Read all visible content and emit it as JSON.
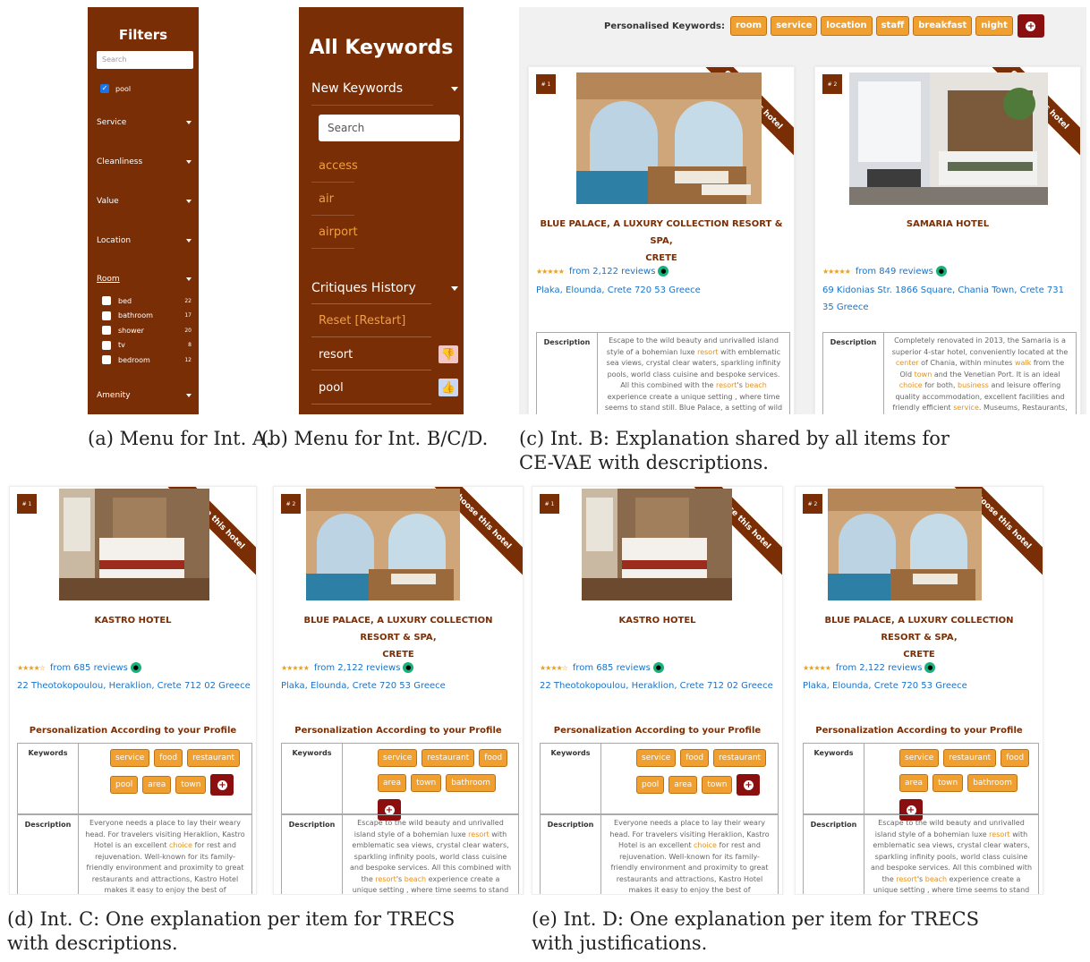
{
  "captions": {
    "a": "(a) Menu for Int. A.",
    "b": "(b) Menu for Int. B/C/D.",
    "c1": "(c) Int. B: Explanation shared by all items for",
    "c2": "CE-VAE with descriptions.",
    "d1": "(d) Int.  C: One explanation per item for TRECS",
    "d2": "with descriptions.",
    "e1": "(e) Int. D: One explanation per item for TRECS",
    "e2": "with justifications."
  },
  "menu_a": {
    "title": "Filters",
    "search_placeholder": "Search",
    "checked_item": "pool",
    "sections": [
      "Service",
      "Cleanliness",
      "Value",
      "Location",
      "Room",
      "Amenity"
    ],
    "room_items": [
      {
        "label": "bed",
        "count": "22"
      },
      {
        "label": "bathroom",
        "count": "17"
      },
      {
        "label": "shower",
        "count": "20"
      },
      {
        "label": "tv",
        "count": "8"
      },
      {
        "label": "bedroom",
        "count": "12"
      }
    ]
  },
  "menu_b": {
    "title": "All Keywords",
    "new_keywords": "New Keywords",
    "search_placeholder": "Search",
    "keywords": [
      "access",
      "air",
      "airport"
    ],
    "critiques_history": "Critiques History",
    "reset": "Reset [Restart]",
    "history": [
      {
        "label": "resort",
        "vote": "down"
      },
      {
        "label": "pool",
        "vote": "up"
      }
    ]
  },
  "common": {
    "ribbon": "Choose this hotel",
    "description_label": "Description",
    "keywords_label": "Keywords",
    "personalization_title": "Personalization According to your Profile",
    "plus": "+"
  },
  "panel_c": {
    "personalised_label": "Personalised Keywords:",
    "keywords": [
      "room",
      "service",
      "location",
      "staff",
      "breakfast",
      "night"
    ],
    "hotels": [
      {
        "rank": "# 1",
        "name_line1": "BLUE PALACE, A LUXURY COLLECTION RESORT & SPA,",
        "name_line2": "CRETE",
        "stars": "★★★★★",
        "reviews": "from 2,122 reviews",
        "address": "Plaka, Elounda, Crete 720 53 Greece",
        "desc": {
          "p1": "Escape to the wild beauty and unrivalled island style of a bohemian luxe ",
          "h1": "resort",
          "p2": " with emblematic sea views, crystal clear waters, sparkling infinity pools, world class cuisine and bespoke services. All this combined with the ",
          "h2": "resort",
          "p3": "'s ",
          "h3": "beach",
          "p4": " experience create a unique setting , where time seems to stand still. Blue Palace, a setting of wild grandeur."
        }
      },
      {
        "rank": "# 2",
        "name_line1": "SAMARIA HOTEL",
        "stars": "★★★★★",
        "reviews": "from 849 reviews",
        "address": "69 Kidonias Str. 1866 Square, Chania Town, Crete 731 35 Greece",
        "desc": {
          "p1": "Completely renovated in 2013, the Samaria is a superior 4-star hotel, conveniently located at the ",
          "h1": "center",
          "p2": " of Chania, within minutes ",
          "h2": "walk",
          "p3": " from the Old ",
          "h3": "town",
          "p4": " and the Venetian Port. It is an ideal ",
          "h4": "choice",
          "p5": " for both, ",
          "h5": "business",
          "p6": " and leisure offering quality accommodation, excellent facilities and friendly efficient ",
          "h6": "service",
          "p7": ". Museums, Restaurants, bars, shops"
        }
      }
    ]
  },
  "kastro": {
    "rank": "# 1",
    "name": "KASTRO HOTEL",
    "stars": "★★★★☆",
    "reviews": "from 685 reviews",
    "address": "22 Theotokopoulou, Heraklion, Crete 712 02 Greece",
    "keywords": [
      "service",
      "food",
      "restaurant",
      "pool",
      "area",
      "town"
    ],
    "desc": {
      "p1": "Everyone needs a place to lay their weary head. For travelers visiting Heraklion, Kastro Hotel is an excellent ",
      "h1": "choice",
      "p2": " for rest and rejuvenation. Well-known for its family-friendly environment and proximity to great restaurants and attractions, Kastro Hotel makes it easy to enjoy the best of Heraklion.Rooms at Kastro Hotel offer a flat screen"
    }
  },
  "blue": {
    "rank": "# 2",
    "name_line1": "BLUE PALACE, A LUXURY COLLECTION RESORT & SPA,",
    "name_line2": "CRETE",
    "stars": "★★★★★",
    "reviews": "from 2,122 reviews",
    "address": "Plaka, Elounda, Crete 720 53 Greece",
    "keywords": [
      "service",
      "restaurant",
      "food",
      "area",
      "town",
      "bathroom"
    ]
  },
  "colors": {
    "brand": "#7a2e05",
    "tag": "#f0a030",
    "plus": "#8b0f0f",
    "link": "#1a73c8"
  }
}
